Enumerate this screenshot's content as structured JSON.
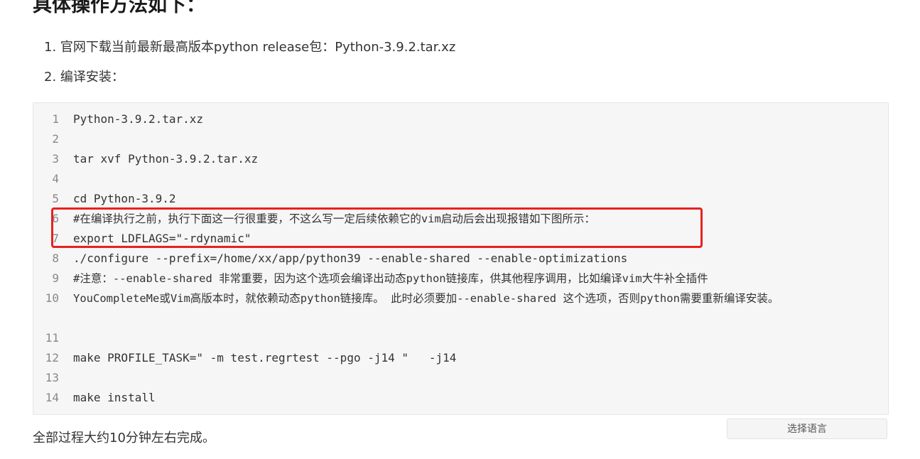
{
  "heading": "具体操作方法如下：",
  "steps": [
    "1. 官网下载当前最新最高版本python release包：Python-3.9.2.tar.xz",
    "2. 编译安装："
  ],
  "code_lines": [
    {
      "num": "1",
      "text": "Python-3.9.2.tar.xz"
    },
    {
      "num": "2",
      "text": ""
    },
    {
      "num": "3",
      "text": "tar xvf Python-3.9.2.tar.xz"
    },
    {
      "num": "4",
      "text": ""
    },
    {
      "num": "5",
      "text": "cd Python-3.9.2"
    },
    {
      "num": "6",
      "text": "#在编译执行之前，执行下面这一行很重要，不这么写一定后续依赖它的vim启动后会出现报错如下图所示："
    },
    {
      "num": "7",
      "text": "export LDFLAGS=\"-rdynamic\""
    },
    {
      "num": "8",
      "text": "./configure --prefix=/home/xx/app/python39 --enable-shared --enable-optimizations"
    },
    {
      "num": "9",
      "text": "#注意：--enable-shared 非常重要，因为这个选项会编译出动态python链接库，供其他程序调用，比如编译vim大牛补全插件"
    },
    {
      "num": "10",
      "text": "YouCompleteMe或Vim高版本时，就依赖动态python链接库。 此时必须要加--enable-shared 这个选项，否则python需要重新编译安装。"
    },
    {
      "num": "11",
      "text": ""
    },
    {
      "num": "12",
      "text": "make PROFILE_TASK=\" -m test.regrtest --pgo -j14 \"   -j14"
    },
    {
      "num": "13",
      "text": ""
    },
    {
      "num": "14",
      "text": "make install"
    }
  ],
  "language_button": "选择语言",
  "footer": "全部过程大约10分钟左右完成。",
  "colors": {
    "highlight_border": "#e8211d",
    "code_bg": "#f6f6f6"
  }
}
